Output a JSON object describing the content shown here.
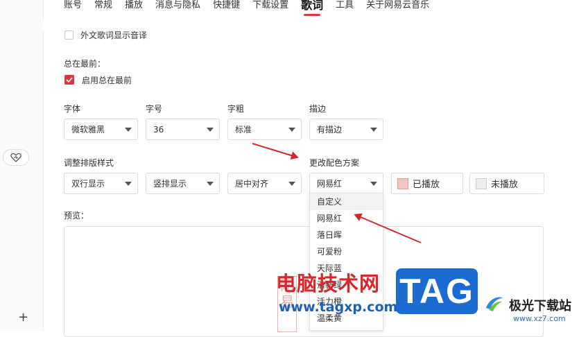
{
  "nav_tabs": [
    {
      "label": "账号"
    },
    {
      "label": "常规"
    },
    {
      "label": "播放"
    },
    {
      "label": "消息与隐私"
    },
    {
      "label": "快捷键"
    },
    {
      "label": "下载设置"
    },
    {
      "label": "歌词",
      "active": true
    },
    {
      "label": "工具"
    },
    {
      "label": "关于网易云音乐"
    }
  ],
  "lyrics": {
    "foreign_pronunciation_label": "外文歌词显示音译",
    "always_on_top": {
      "heading": "总在最前：",
      "checkbox_label": "启用总在最前",
      "checked": true
    },
    "font": {
      "label": "字体",
      "value": "微软雅黑"
    },
    "size": {
      "label": "字号",
      "value": "36"
    },
    "weight": {
      "label": "字粗",
      "value": "标准"
    },
    "stroke": {
      "label": "描边",
      "value": "有描边"
    },
    "layout_label": "调整排版样式",
    "layout_rows": {
      "value": "双行显示"
    },
    "layout_direction": {
      "value": "竖排显示"
    },
    "layout_align": {
      "value": "居中对齐"
    },
    "color_scheme": {
      "label": "更改配色方案",
      "value": "网易红"
    },
    "played_button": {
      "label": "已播放",
      "swatch_color": "#f6c3c3"
    },
    "unplayed_button": {
      "label": "未播放",
      "swatch_color": "#eeeeee"
    },
    "preview_label": "预览：",
    "color_options": [
      "自定义",
      "网易红",
      "落日晖",
      "可爱粉",
      "天际蓝",
      "清新绿",
      "活力橙",
      "温柔黄"
    ]
  },
  "colors": {
    "accent": "#e0383e",
    "checkbox": "#d8373d",
    "annotation_arrow": "#d4262b"
  },
  "icons": {
    "favorite": "heart-icon",
    "add": "plus-icon",
    "dropdown": "chevron-down-icon",
    "check": "check-icon"
  },
  "watermark": {
    "cn_text": "电脑技术网",
    "url": "www.tagxp.com",
    "tag": "TAG",
    "site_name": "极光下载站",
    "site_url": "www.xz7.com",
    "seal_text": "网易"
  }
}
